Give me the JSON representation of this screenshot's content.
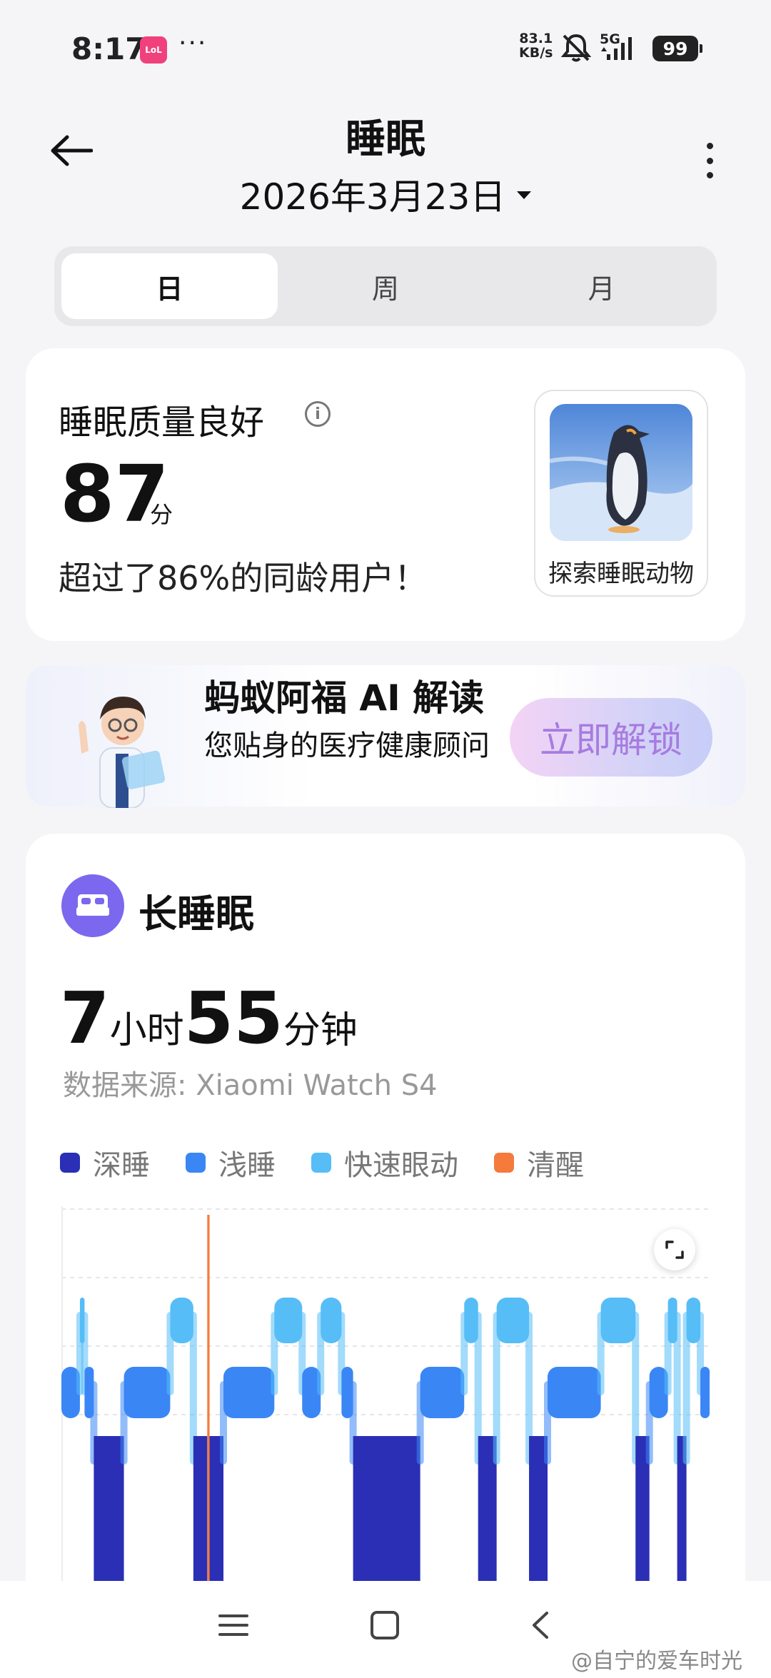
{
  "status_bar": {
    "time": "8:17",
    "app_badge": "LoL",
    "more": "···",
    "net_speed_value": "83.1",
    "net_speed_unit": "KB/s",
    "network": "5G",
    "battery": "99"
  },
  "header": {
    "title": "睡眠",
    "date": "2026年3月23日"
  },
  "tabs": [
    {
      "label": "日",
      "active": true
    },
    {
      "label": "周",
      "active": false
    },
    {
      "label": "月",
      "active": false
    }
  ],
  "quality": {
    "title": "睡眠质量良好",
    "info_icon": "i",
    "score": "87",
    "score_unit": "分",
    "compare_text": "超过了86%的同龄用户！",
    "animal_label": "探索睡眠动物"
  },
  "ai": {
    "title": "蚂蚁阿福 AI 解读",
    "subtitle": "您贴身的医疗健康顾问",
    "button": "立即解锁"
  },
  "long_sleep": {
    "title": "长睡眠",
    "hours": "7",
    "hours_unit": "小时",
    "minutes": "55",
    "minutes_unit": "分钟",
    "source": "数据来源: Xiaomi Watch S4"
  },
  "legend": [
    {
      "label": "深睡",
      "color": "#2a2fb5"
    },
    {
      "label": "浅睡",
      "color": "#3a86f5"
    },
    {
      "label": "快速眼动",
      "color": "#56bdf7"
    },
    {
      "label": "清醒",
      "color": "#f47b3b"
    }
  ],
  "chart_data": {
    "type": "bar",
    "stage_levels": [
      "清醒",
      "快速眼动",
      "浅睡",
      "深睡"
    ],
    "colors": {
      "清醒": "#f47b3b",
      "快速眼动": "#56bdf7",
      "浅睡": "#3a86f5",
      "深睡": "#2a2fb5"
    },
    "segments": [
      {
        "stage": "浅睡",
        "start": 0.0,
        "end": 0.8
      },
      {
        "stage": "快速眼动",
        "start": 0.8,
        "end": 1.0
      },
      {
        "stage": "浅睡",
        "start": 1.0,
        "end": 1.4
      },
      {
        "stage": "深睡",
        "start": 1.4,
        "end": 2.7
      },
      {
        "stage": "浅睡",
        "start": 2.7,
        "end": 4.7
      },
      {
        "stage": "快速眼动",
        "start": 4.7,
        "end": 5.7
      },
      {
        "stage": "深睡",
        "start": 5.7,
        "end": 6.3
      },
      {
        "stage": "清醒",
        "start": 6.3,
        "end": 6.4
      },
      {
        "stage": "深睡",
        "start": 6.4,
        "end": 7.0
      },
      {
        "stage": "浅睡",
        "start": 7.0,
        "end": 9.2
      },
      {
        "stage": "快速眼动",
        "start": 9.2,
        "end": 10.4
      },
      {
        "stage": "浅睡",
        "start": 10.4,
        "end": 11.2
      },
      {
        "stage": "快速眼动",
        "start": 11.2,
        "end": 12.1
      },
      {
        "stage": "浅睡",
        "start": 12.1,
        "end": 12.6
      },
      {
        "stage": "深睡",
        "start": 12.6,
        "end": 15.5
      },
      {
        "stage": "浅睡",
        "start": 15.5,
        "end": 17.4
      },
      {
        "stage": "快速眼动",
        "start": 17.4,
        "end": 18.0
      },
      {
        "stage": "深睡",
        "start": 18.0,
        "end": 18.8
      },
      {
        "stage": "快速眼动",
        "start": 18.8,
        "end": 20.2
      },
      {
        "stage": "深睡",
        "start": 20.2,
        "end": 21.0
      },
      {
        "stage": "浅睡",
        "start": 21.0,
        "end": 23.3
      },
      {
        "stage": "快速眼动",
        "start": 23.3,
        "end": 24.8
      },
      {
        "stage": "深睡",
        "start": 24.8,
        "end": 25.4
      },
      {
        "stage": "浅睡",
        "start": 25.4,
        "end": 26.2
      },
      {
        "stage": "快速眼动",
        "start": 26.2,
        "end": 26.6
      },
      {
        "stage": "深睡",
        "start": 26.6,
        "end": 27.0
      },
      {
        "stage": "快速眼动",
        "start": 27.0,
        "end": 27.6
      },
      {
        "stage": "浅睡",
        "start": 27.6,
        "end": 28.0
      }
    ]
  },
  "nav": {
    "menu_icon": "menu-icon",
    "home_icon": "home-square-icon",
    "back_icon": "back-chevron-icon"
  },
  "watermark": "@自宁的爱车时光"
}
